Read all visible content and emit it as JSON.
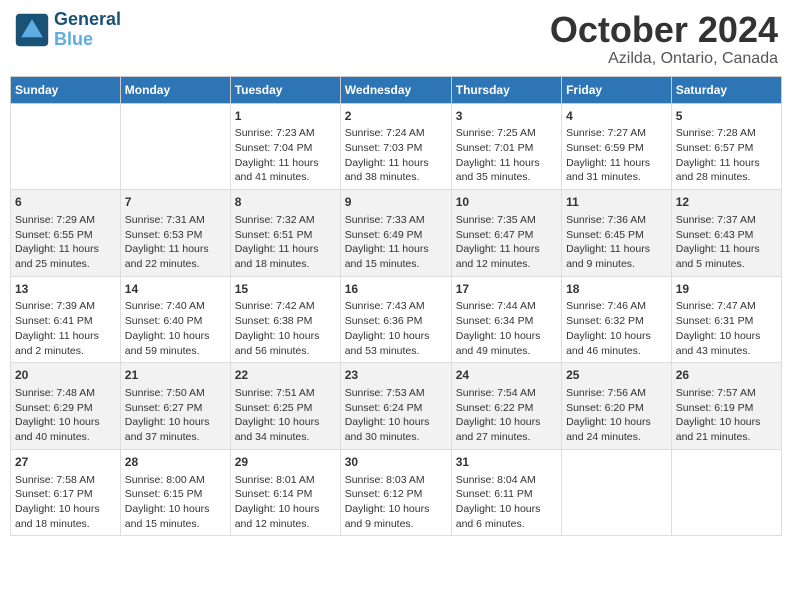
{
  "header": {
    "logo_line1": "General",
    "logo_line2": "Blue",
    "title": "October 2024",
    "subtitle": "Azilda, Ontario, Canada"
  },
  "days_of_week": [
    "Sunday",
    "Monday",
    "Tuesday",
    "Wednesday",
    "Thursday",
    "Friday",
    "Saturday"
  ],
  "weeks": [
    [
      {
        "day": "",
        "sunrise": "",
        "sunset": "",
        "daylight": ""
      },
      {
        "day": "",
        "sunrise": "",
        "sunset": "",
        "daylight": ""
      },
      {
        "day": "1",
        "sunrise": "Sunrise: 7:23 AM",
        "sunset": "Sunset: 7:04 PM",
        "daylight": "Daylight: 11 hours and 41 minutes."
      },
      {
        "day": "2",
        "sunrise": "Sunrise: 7:24 AM",
        "sunset": "Sunset: 7:03 PM",
        "daylight": "Daylight: 11 hours and 38 minutes."
      },
      {
        "day": "3",
        "sunrise": "Sunrise: 7:25 AM",
        "sunset": "Sunset: 7:01 PM",
        "daylight": "Daylight: 11 hours and 35 minutes."
      },
      {
        "day": "4",
        "sunrise": "Sunrise: 7:27 AM",
        "sunset": "Sunset: 6:59 PM",
        "daylight": "Daylight: 11 hours and 31 minutes."
      },
      {
        "day": "5",
        "sunrise": "Sunrise: 7:28 AM",
        "sunset": "Sunset: 6:57 PM",
        "daylight": "Daylight: 11 hours and 28 minutes."
      }
    ],
    [
      {
        "day": "6",
        "sunrise": "Sunrise: 7:29 AM",
        "sunset": "Sunset: 6:55 PM",
        "daylight": "Daylight: 11 hours and 25 minutes."
      },
      {
        "day": "7",
        "sunrise": "Sunrise: 7:31 AM",
        "sunset": "Sunset: 6:53 PM",
        "daylight": "Daylight: 11 hours and 22 minutes."
      },
      {
        "day": "8",
        "sunrise": "Sunrise: 7:32 AM",
        "sunset": "Sunset: 6:51 PM",
        "daylight": "Daylight: 11 hours and 18 minutes."
      },
      {
        "day": "9",
        "sunrise": "Sunrise: 7:33 AM",
        "sunset": "Sunset: 6:49 PM",
        "daylight": "Daylight: 11 hours and 15 minutes."
      },
      {
        "day": "10",
        "sunrise": "Sunrise: 7:35 AM",
        "sunset": "Sunset: 6:47 PM",
        "daylight": "Daylight: 11 hours and 12 minutes."
      },
      {
        "day": "11",
        "sunrise": "Sunrise: 7:36 AM",
        "sunset": "Sunset: 6:45 PM",
        "daylight": "Daylight: 11 hours and 9 minutes."
      },
      {
        "day": "12",
        "sunrise": "Sunrise: 7:37 AM",
        "sunset": "Sunset: 6:43 PM",
        "daylight": "Daylight: 11 hours and 5 minutes."
      }
    ],
    [
      {
        "day": "13",
        "sunrise": "Sunrise: 7:39 AM",
        "sunset": "Sunset: 6:41 PM",
        "daylight": "Daylight: 11 hours and 2 minutes."
      },
      {
        "day": "14",
        "sunrise": "Sunrise: 7:40 AM",
        "sunset": "Sunset: 6:40 PM",
        "daylight": "Daylight: 10 hours and 59 minutes."
      },
      {
        "day": "15",
        "sunrise": "Sunrise: 7:42 AM",
        "sunset": "Sunset: 6:38 PM",
        "daylight": "Daylight: 10 hours and 56 minutes."
      },
      {
        "day": "16",
        "sunrise": "Sunrise: 7:43 AM",
        "sunset": "Sunset: 6:36 PM",
        "daylight": "Daylight: 10 hours and 53 minutes."
      },
      {
        "day": "17",
        "sunrise": "Sunrise: 7:44 AM",
        "sunset": "Sunset: 6:34 PM",
        "daylight": "Daylight: 10 hours and 49 minutes."
      },
      {
        "day": "18",
        "sunrise": "Sunrise: 7:46 AM",
        "sunset": "Sunset: 6:32 PM",
        "daylight": "Daylight: 10 hours and 46 minutes."
      },
      {
        "day": "19",
        "sunrise": "Sunrise: 7:47 AM",
        "sunset": "Sunset: 6:31 PM",
        "daylight": "Daylight: 10 hours and 43 minutes."
      }
    ],
    [
      {
        "day": "20",
        "sunrise": "Sunrise: 7:48 AM",
        "sunset": "Sunset: 6:29 PM",
        "daylight": "Daylight: 10 hours and 40 minutes."
      },
      {
        "day": "21",
        "sunrise": "Sunrise: 7:50 AM",
        "sunset": "Sunset: 6:27 PM",
        "daylight": "Daylight: 10 hours and 37 minutes."
      },
      {
        "day": "22",
        "sunrise": "Sunrise: 7:51 AM",
        "sunset": "Sunset: 6:25 PM",
        "daylight": "Daylight: 10 hours and 34 minutes."
      },
      {
        "day": "23",
        "sunrise": "Sunrise: 7:53 AM",
        "sunset": "Sunset: 6:24 PM",
        "daylight": "Daylight: 10 hours and 30 minutes."
      },
      {
        "day": "24",
        "sunrise": "Sunrise: 7:54 AM",
        "sunset": "Sunset: 6:22 PM",
        "daylight": "Daylight: 10 hours and 27 minutes."
      },
      {
        "day": "25",
        "sunrise": "Sunrise: 7:56 AM",
        "sunset": "Sunset: 6:20 PM",
        "daylight": "Daylight: 10 hours and 24 minutes."
      },
      {
        "day": "26",
        "sunrise": "Sunrise: 7:57 AM",
        "sunset": "Sunset: 6:19 PM",
        "daylight": "Daylight: 10 hours and 21 minutes."
      }
    ],
    [
      {
        "day": "27",
        "sunrise": "Sunrise: 7:58 AM",
        "sunset": "Sunset: 6:17 PM",
        "daylight": "Daylight: 10 hours and 18 minutes."
      },
      {
        "day": "28",
        "sunrise": "Sunrise: 8:00 AM",
        "sunset": "Sunset: 6:15 PM",
        "daylight": "Daylight: 10 hours and 15 minutes."
      },
      {
        "day": "29",
        "sunrise": "Sunrise: 8:01 AM",
        "sunset": "Sunset: 6:14 PM",
        "daylight": "Daylight: 10 hours and 12 minutes."
      },
      {
        "day": "30",
        "sunrise": "Sunrise: 8:03 AM",
        "sunset": "Sunset: 6:12 PM",
        "daylight": "Daylight: 10 hours and 9 minutes."
      },
      {
        "day": "31",
        "sunrise": "Sunrise: 8:04 AM",
        "sunset": "Sunset: 6:11 PM",
        "daylight": "Daylight: 10 hours and 6 minutes."
      },
      {
        "day": "",
        "sunrise": "",
        "sunset": "",
        "daylight": ""
      },
      {
        "day": "",
        "sunrise": "",
        "sunset": "",
        "daylight": ""
      }
    ]
  ]
}
